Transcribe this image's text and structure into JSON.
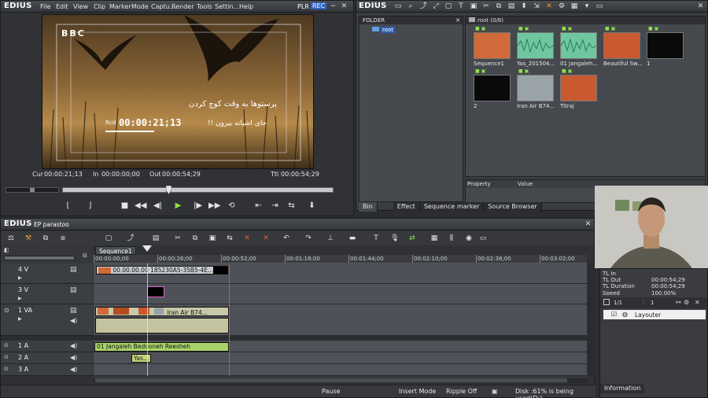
{
  "player": {
    "logo": "EDIUS",
    "menu": [
      "File",
      "Edit",
      "View",
      "Clip",
      "Marker",
      "Mode",
      "Captu...",
      "Render",
      "Tools",
      "Settin...",
      "Help"
    ],
    "plr": "PLR",
    "rec": "REC",
    "overlay": {
      "broadcaster": "BBC",
      "caption_line1": "پرستوها به وقت کوچ کردن",
      "caption_line2": "جای آشیانه بیرون !!",
      "tc_prefix": "Rcd",
      "timecode": "00:00:21;13"
    },
    "timecodes": {
      "cur_label": "Cur",
      "cur": "00:00:21;13",
      "in_label": "In",
      "in": "00:00:00;00",
      "out_label": "Out",
      "out": "00:00:54;29",
      "ttl_label": "Ttl",
      "ttl": "00:00:54;29"
    },
    "scrub_position": 0.39
  },
  "bin": {
    "logo": "EDIUS",
    "folder_header": "FOLDER",
    "root_folder": "root",
    "content_header": "root (0/8)",
    "clips": [
      {
        "label": "Sequence1",
        "kind": "video",
        "color": "#d06a3a"
      },
      {
        "label": "Yas_201504...",
        "kind": "audio",
        "color": "#6fc7a0"
      },
      {
        "label": "01 Jangaleh...",
        "kind": "audio",
        "color": "#6fc7a0"
      },
      {
        "label": "Beautiful Sw...",
        "kind": "video",
        "color": "#c95a30"
      },
      {
        "label": "1",
        "kind": "title",
        "color": "#0a0a0a"
      },
      {
        "label": "2",
        "kind": "title",
        "color": "#0a0a0a"
      },
      {
        "label": "Iran Air B74...",
        "kind": "video",
        "color": "#9aa3a8"
      },
      {
        "label": "Titraj",
        "kind": "video",
        "color": "#c95a30"
      }
    ],
    "props_headers": [
      "Property",
      "Value"
    ],
    "tabs": [
      "Bin",
      "Effect",
      "Sequence marker",
      "Source Browser"
    ]
  },
  "timeline": {
    "logo": "EDIUS",
    "project": "EP parastoo",
    "sequence_tab": "Sequence1",
    "ruler": [
      "00:00:00;00",
      "00:00:26;00",
      "00:00:52;00",
      "00:01:18;00",
      "00:01:44;00",
      "00:02:10;00",
      "00:02:36;00",
      "00:03:02;00"
    ],
    "tracks": [
      {
        "name": "4 V"
      },
      {
        "name": "3 V"
      },
      {
        "name": "1 VA"
      },
      {
        "name": "1 A"
      },
      {
        "name": "2 A"
      },
      {
        "name": "3 A"
      }
    ],
    "clips": {
      "v4": "00.00.00.00  185230A5-35B5-4E...",
      "va1": "Iran Air B74...",
      "a1": "01 Jangaleh Bedooneh Reesheh",
      "a2": "Yas..."
    }
  },
  "status": {
    "mode": "Pause",
    "insert": "Insert Mode",
    "ripple": "Ripple Off",
    "disk": "Disk :61% is being used(D:)"
  },
  "info": {
    "rows": [
      {
        "label": "TL In",
        "value": ""
      },
      {
        "label": "TL Out",
        "value": "00:00:54;29"
      },
      {
        "label": "TL Duration",
        "value": "00:00:54;29"
      },
      {
        "label": "Speed",
        "value": "100.00%"
      }
    ],
    "page": "1/1",
    "count": "1",
    "layouter": "Layouter",
    "tab": "Information"
  }
}
